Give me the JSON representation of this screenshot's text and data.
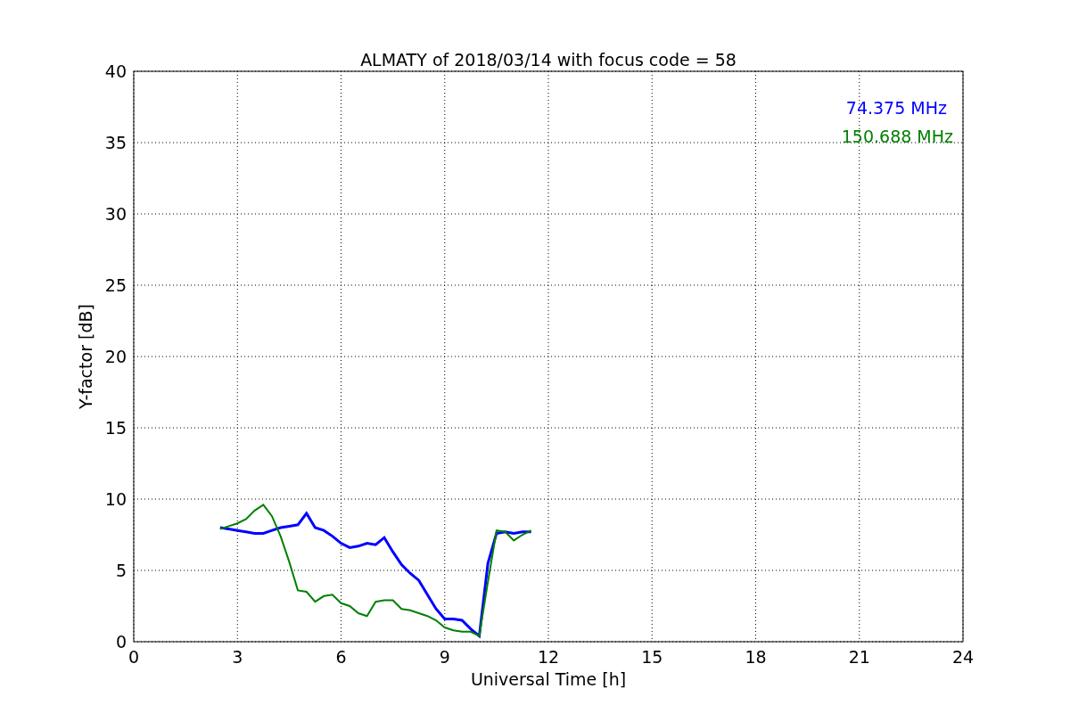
{
  "chart_data": {
    "type": "line",
    "title": "ALMATY of 2018/03/14 with focus code = 58",
    "xlabel": "Universal Time [h]",
    "ylabel": "Y-factor [dB]",
    "x": [
      2.5,
      2.75,
      3,
      3.25,
      3.5,
      3.75,
      4,
      4.25,
      4.5,
      4.75,
      5,
      5.25,
      5.5,
      5.75,
      6,
      6.25,
      6.5,
      6.75,
      7,
      7.25,
      7.5,
      7.75,
      8,
      8.25,
      8.5,
      8.75,
      9,
      9.25,
      9.5,
      9.75,
      10,
      10.25,
      10.5,
      10.75,
      11,
      11.25,
      11.5
    ],
    "series": [
      {
        "name": "74.375 MHz",
        "color": "#0000ff",
        "values": [
          8.0,
          7.9,
          7.8,
          7.7,
          7.6,
          7.6,
          7.8,
          8.0,
          8.1,
          8.2,
          9.0,
          8.0,
          7.8,
          7.4,
          6.9,
          6.6,
          6.7,
          6.9,
          6.8,
          7.3,
          6.3,
          5.4,
          4.8,
          4.3,
          3.3,
          2.3,
          1.6,
          1.6,
          1.5,
          0.9,
          0.4,
          5.5,
          7.6,
          7.7,
          7.6,
          7.7,
          7.7
        ]
      },
      {
        "name": "150.688 MHz",
        "color": "#008000",
        "values": [
          7.9,
          8.1,
          8.3,
          8.6,
          9.2,
          9.6,
          8.8,
          7.4,
          5.6,
          3.6,
          3.5,
          2.8,
          3.2,
          3.3,
          2.7,
          2.5,
          2.0,
          1.8,
          2.8,
          2.9,
          2.9,
          2.3,
          2.2,
          2.0,
          1.8,
          1.5,
          1.0,
          0.8,
          0.7,
          0.7,
          0.4,
          4.2,
          7.8,
          7.7,
          7.1,
          7.5,
          7.8
        ]
      }
    ],
    "xlim": [
      0,
      24
    ],
    "ylim": [
      0,
      40
    ],
    "xticks": [
      0,
      3,
      6,
      9,
      12,
      15,
      18,
      21,
      24
    ],
    "yticks": [
      0,
      5,
      10,
      15,
      20,
      25,
      30,
      35,
      40
    ],
    "grid": true
  }
}
